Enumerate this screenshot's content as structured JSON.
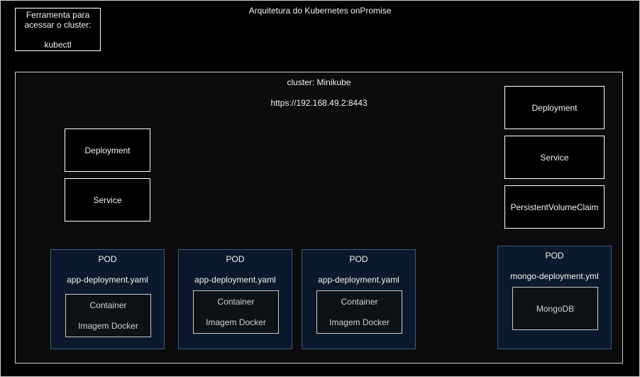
{
  "title": "Arquitetura do Kubernetes onPromise",
  "tool_box": {
    "line1": "Ferramenta para",
    "line2": "acessar o cluster:",
    "line3": "kubectl"
  },
  "cluster": {
    "label": "cluster: Minikube",
    "url": "https://192.168.49.2:8443"
  },
  "left_resources": {
    "deployment": "Deployment",
    "service": "Service"
  },
  "right_resources": {
    "deployment": "Deployment",
    "service": "Service",
    "pvc": "PersistentVolumeClaim"
  },
  "pods": [
    {
      "title": "POD",
      "file": "app-deployment.yaml",
      "container": "Container",
      "image": "Imagem Docker"
    },
    {
      "title": "POD",
      "file": "app-deployment.yaml",
      "container": "Container",
      "image": "Imagem Docker"
    },
    {
      "title": "POD",
      "file": "app-deployment.yaml",
      "container": "Container",
      "image": "Imagem Docker"
    }
  ],
  "mongo_pod": {
    "title": "POD",
    "file": "mongo-deployment.yml",
    "container": "MongoDB"
  }
}
